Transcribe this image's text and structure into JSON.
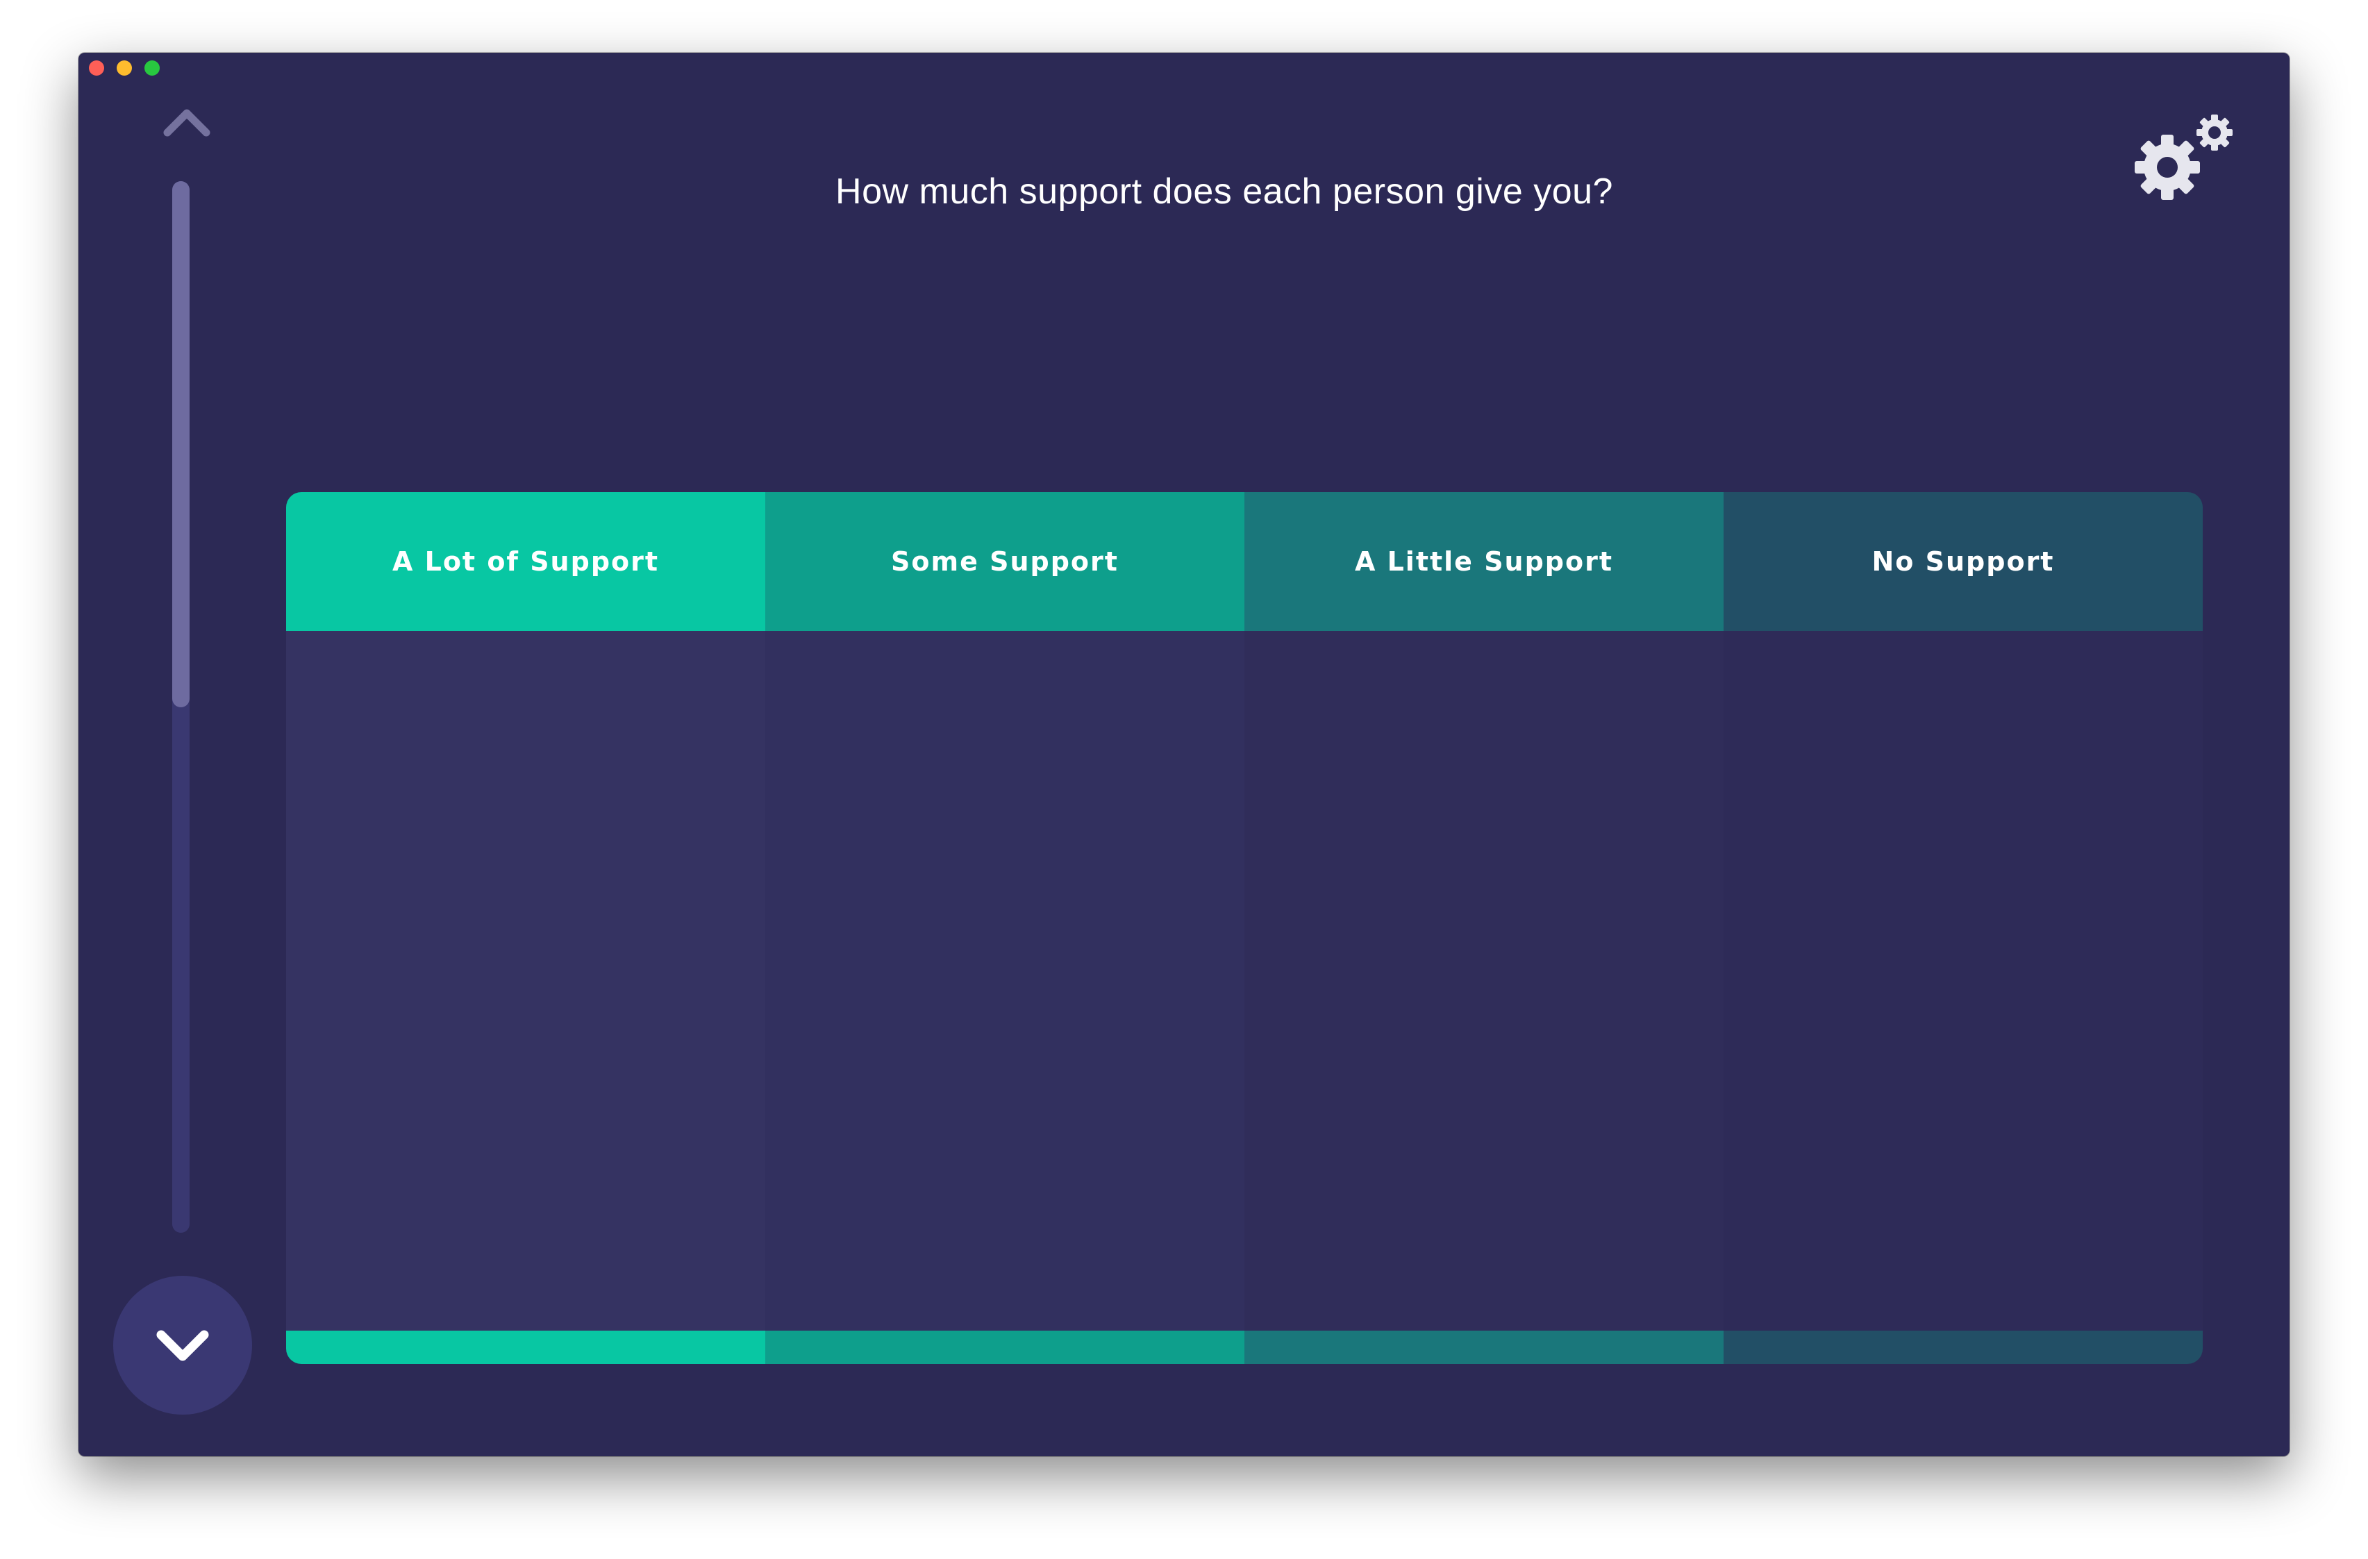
{
  "window": {
    "traffic_lights": [
      "close",
      "minimize",
      "zoom"
    ]
  },
  "question": "How much support does each person give you?",
  "navigation": {
    "up_icon": "chevron-up-icon",
    "down_icon": "chevron-down-icon",
    "scroll_position": 0.0,
    "scroll_visible_fraction": 0.5
  },
  "settings": {
    "icon": "gear-icon"
  },
  "columns": [
    {
      "label": "A Lot of Support",
      "header_color": "#08c7a3",
      "body_color": "#353362",
      "footer_color": "#08c7a3"
    },
    {
      "label": "Some Support",
      "header_color": "#0e9f8c",
      "body_color": "#32305f",
      "footer_color": "#0e9f8c"
    },
    {
      "label": "A Little Support",
      "header_color": "#1a777b",
      "body_color": "#302d5a",
      "footer_color": "#1a777b"
    },
    {
      "label": "No Support",
      "header_color": "#224f66",
      "body_color": "#2e2b58",
      "footer_color": "#224f66"
    }
  ]
}
